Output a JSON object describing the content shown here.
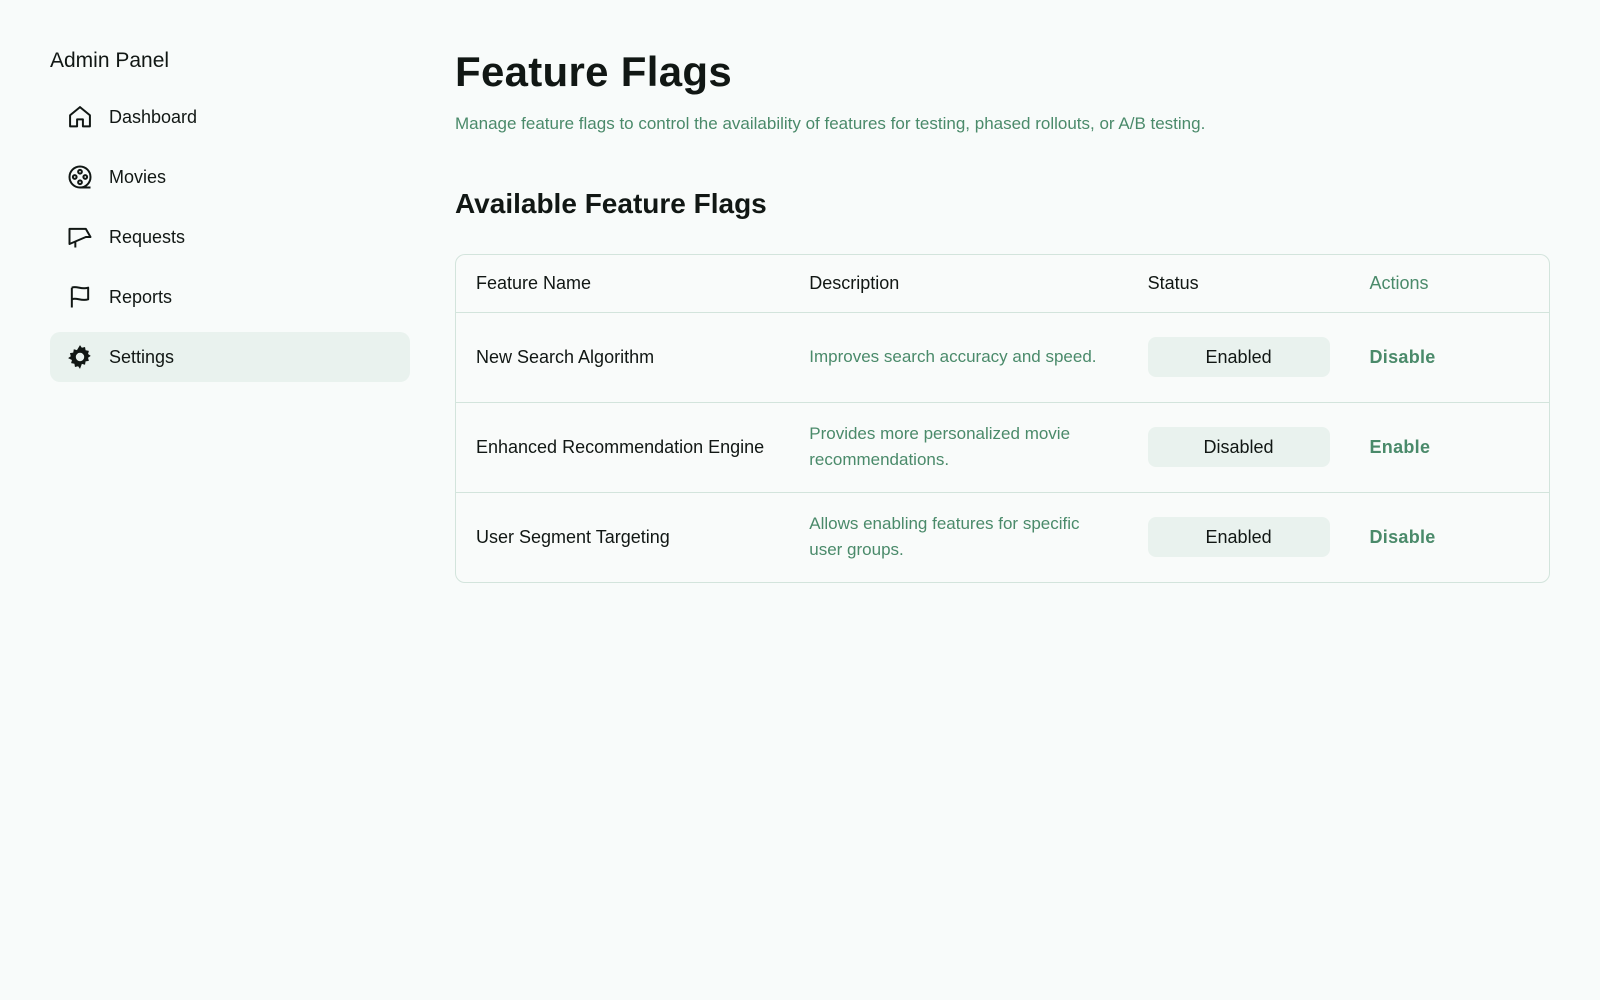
{
  "sidebar": {
    "title": "Admin Panel",
    "items": [
      {
        "label": "Dashboard",
        "icon": "home-icon",
        "active": false
      },
      {
        "label": "Movies",
        "icon": "film-reel-icon",
        "active": false
      },
      {
        "label": "Requests",
        "icon": "megaphone-icon",
        "active": false
      },
      {
        "label": "Reports",
        "icon": "flag-icon",
        "active": false
      },
      {
        "label": "Settings",
        "icon": "gear-icon",
        "active": true
      }
    ]
  },
  "main": {
    "title": "Feature Flags",
    "subtitle": "Manage feature flags to control the availability of features for testing, phased rollouts, or A/B testing.",
    "section_title": "Available Feature Flags",
    "table": {
      "headers": [
        "Feature Name",
        "Description",
        "Status",
        "Actions"
      ],
      "rows": [
        {
          "name": "New Search Algorithm",
          "description": "Improves search accuracy and speed.",
          "status": "Enabled",
          "action": "Disable"
        },
        {
          "name": "Enhanced Recommendation Engine",
          "description": "Provides more personalized movie recommendations.",
          "status": "Disabled",
          "action": "Enable"
        },
        {
          "name": "User Segment Targeting",
          "description": "Allows enabling features for specific user groups.",
          "status": "Enabled",
          "action": "Disable"
        }
      ]
    }
  },
  "colors": {
    "background": "#f8fbfa",
    "accent": "#4a8a6a",
    "active_bg": "#e9f2ee",
    "border": "#d3e4dc",
    "text": "#111714"
  }
}
